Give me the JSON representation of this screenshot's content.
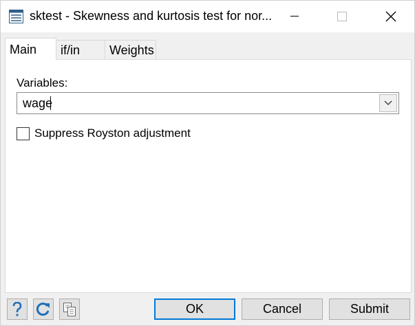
{
  "window": {
    "title": "sktest - Skewness and kurtosis test for nor...",
    "icon": "dialog-list-icon"
  },
  "tabs": [
    {
      "label": "Main",
      "active": true
    },
    {
      "label": "if/in",
      "active": false
    },
    {
      "label": "Weights",
      "active": false
    }
  ],
  "main": {
    "variables_label": "Variables:",
    "variables_value": "wage",
    "royston_label": "Suppress Royston adjustment",
    "royston_checked": false
  },
  "footer": {
    "ok": "OK",
    "cancel": "Cancel",
    "submit": "Submit",
    "help_icon": "question-icon",
    "reset_icon": "refresh-icon",
    "copy_icon": "copy-icon"
  },
  "colors": {
    "accent": "#0078d7",
    "icon_blue": "#1e6fb8"
  }
}
